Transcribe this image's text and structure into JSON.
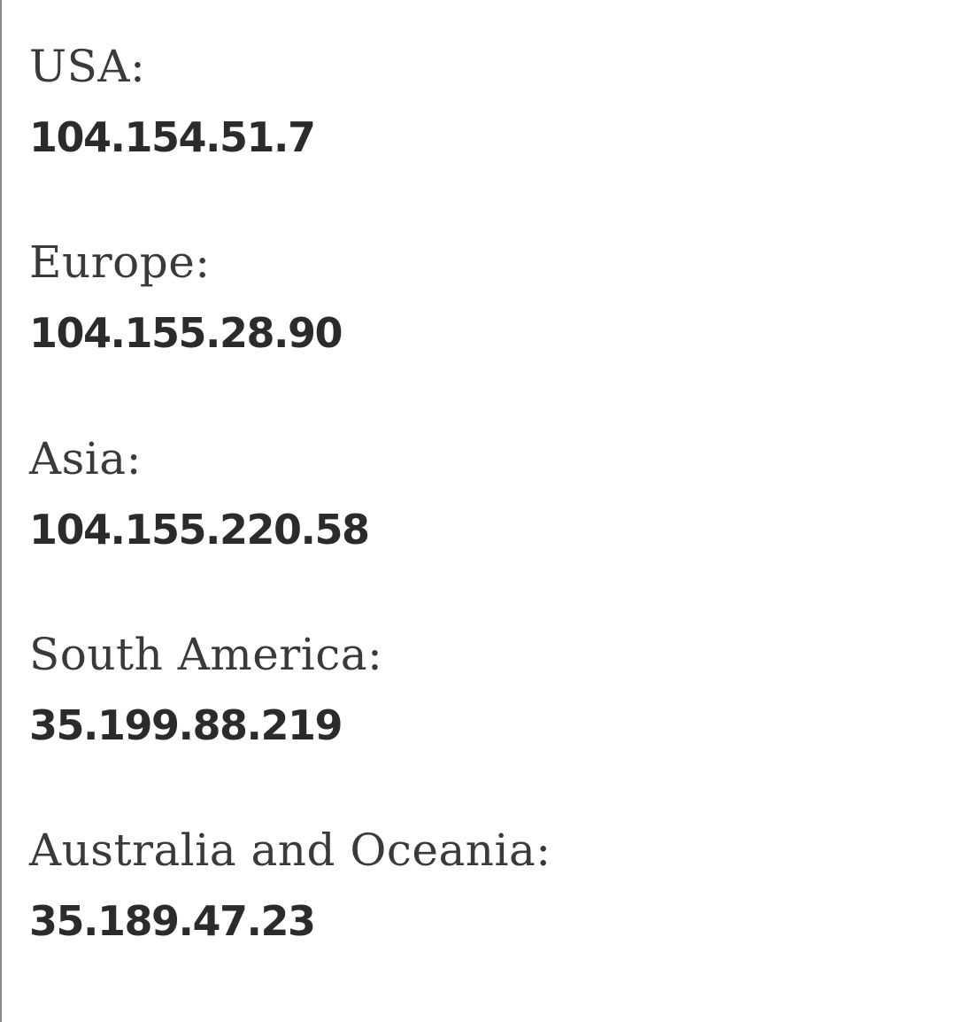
{
  "servers": [
    {
      "region": "USA:",
      "ip": "104.154.51.7"
    },
    {
      "region": "Europe:",
      "ip": "104.155.28.90"
    },
    {
      "region": "Asia:",
      "ip": "104.155.220.58"
    },
    {
      "region": "South America:",
      "ip": "35.199.88.219"
    },
    {
      "region": "Australia and Oceania:",
      "ip": "35.189.47.23"
    }
  ]
}
